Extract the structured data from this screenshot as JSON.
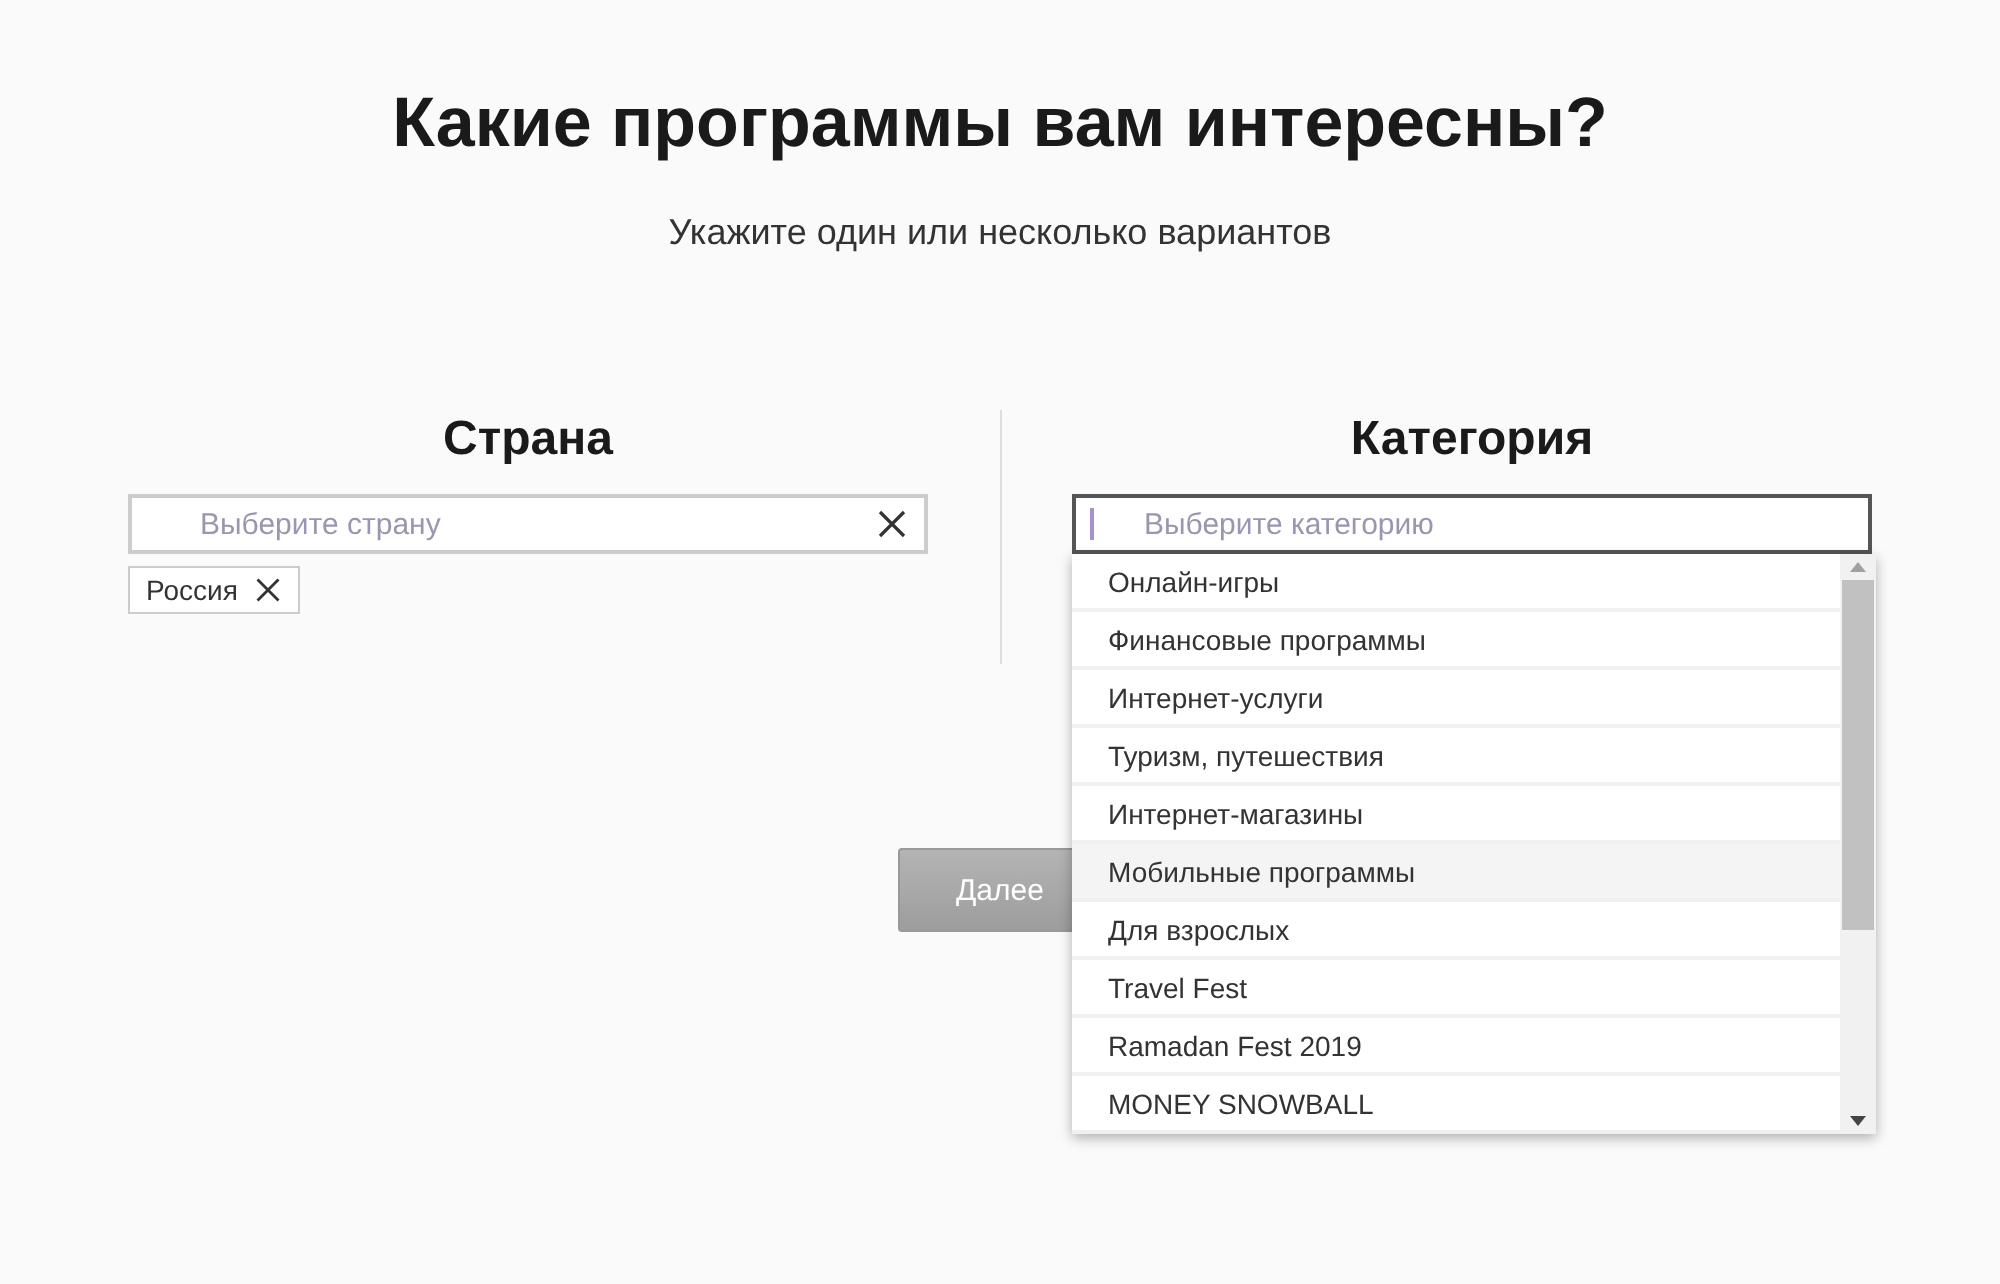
{
  "title": "Какие программы вам интересны?",
  "subtitle": "Укажите один или несколько вариантов",
  "country": {
    "label": "Страна",
    "placeholder": "Выберите страну",
    "tags": [
      {
        "label": "Россия"
      }
    ]
  },
  "category": {
    "label": "Категория",
    "placeholder": "Выберите категорию",
    "focused": true,
    "options": [
      {
        "label": "Онлайн-игры",
        "selected": false
      },
      {
        "label": "Финансовые программы",
        "selected": false
      },
      {
        "label": "Интернет-услуги",
        "selected": false
      },
      {
        "label": "Туризм, путешествия",
        "selected": false
      },
      {
        "label": "Интернет-магазины",
        "selected": false
      },
      {
        "label": "Мобильные программы",
        "selected": true
      },
      {
        "label": "Для взрослых",
        "selected": false
      },
      {
        "label": "Travel Fest",
        "selected": false
      },
      {
        "label": "Ramadan Fest 2019",
        "selected": false
      },
      {
        "label": "MONEY SNOWBALL",
        "selected": false
      }
    ]
  },
  "next_button": "Далее"
}
